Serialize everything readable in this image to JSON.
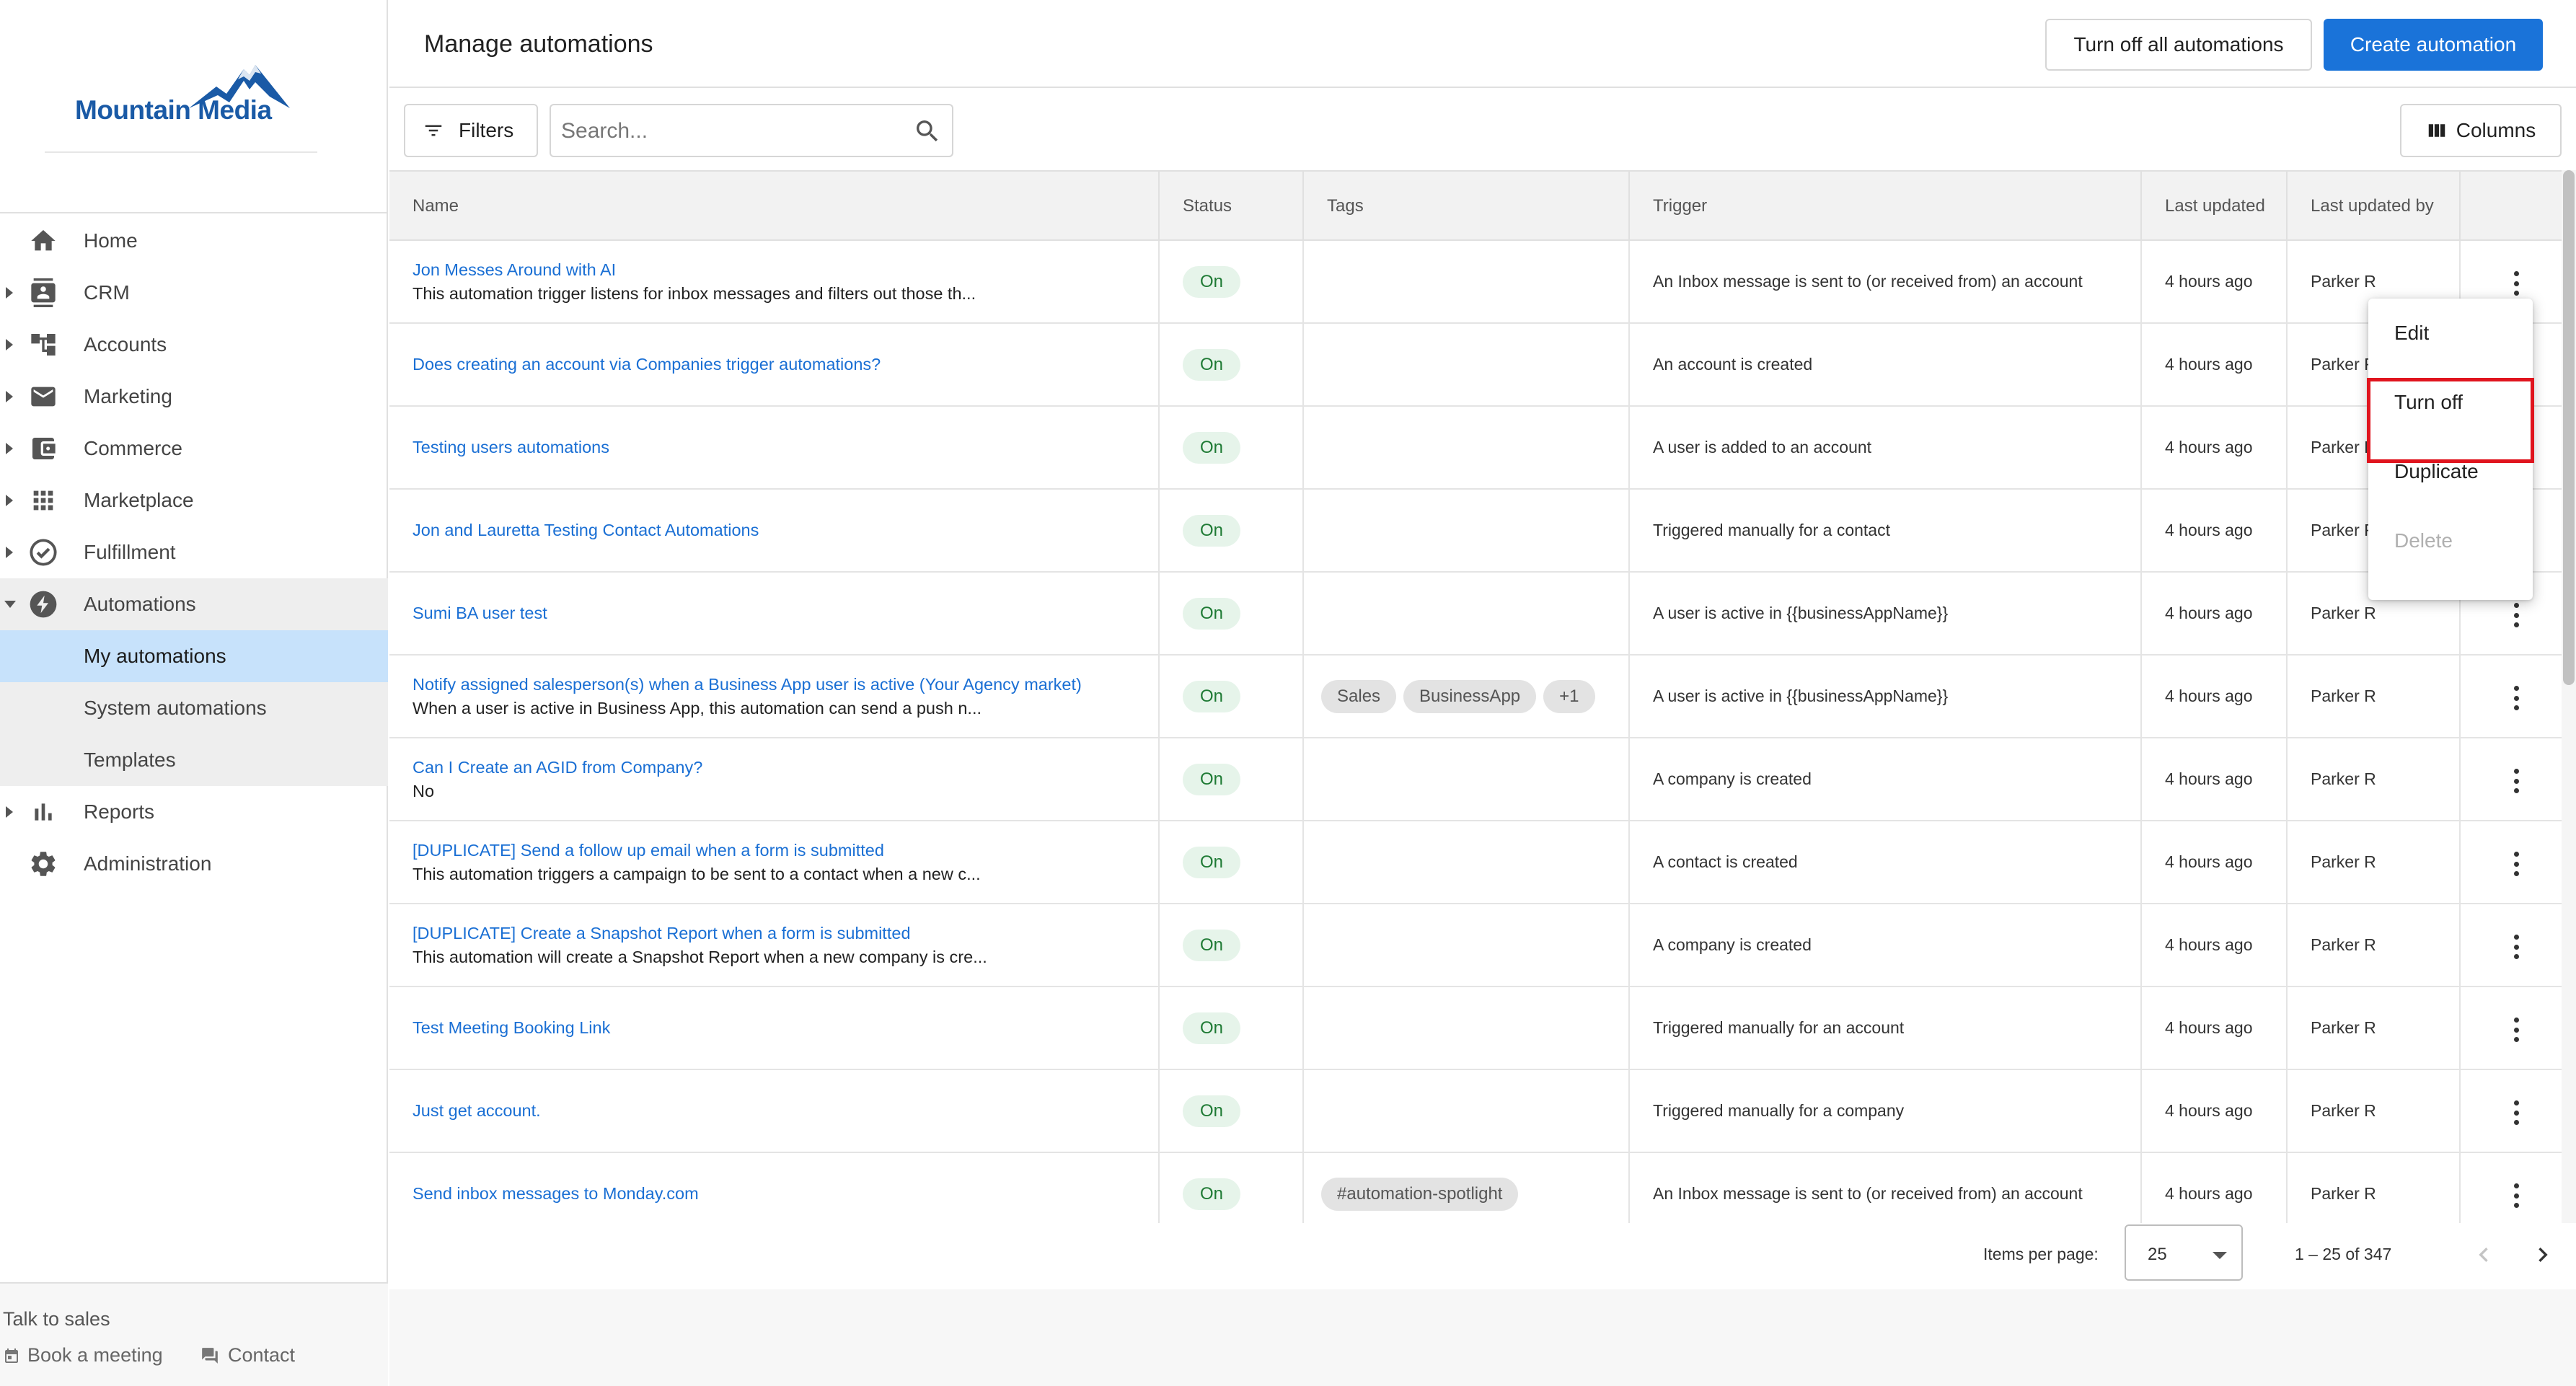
{
  "brand": {
    "name": "Mountain Media",
    "color": "#1a5aa6"
  },
  "sidebar": {
    "nav": [
      {
        "label": "Home",
        "icon": "home-icon"
      },
      {
        "label": "CRM",
        "icon": "contacts-icon"
      },
      {
        "label": "Accounts",
        "icon": "hierarchy-icon"
      },
      {
        "label": "Marketing",
        "icon": "mail-icon"
      },
      {
        "label": "Commerce",
        "icon": "wallet-icon"
      },
      {
        "label": "Marketplace",
        "icon": "apps-grid-icon"
      },
      {
        "label": "Fulfillment",
        "icon": "check-circle-icon"
      },
      {
        "label": "Automations",
        "icon": "bolt-icon"
      },
      {
        "label": "My automations"
      },
      {
        "label": "System automations"
      },
      {
        "label": "Templates"
      },
      {
        "label": "Reports",
        "icon": "bar-chart-icon"
      },
      {
        "label": "Administration",
        "icon": "gear-icon"
      }
    ],
    "talk_label": "Talk to sales",
    "book_meeting": "Book a meeting",
    "contact": "Contact"
  },
  "header": {
    "title": "Manage automations",
    "turn_off_all": "Turn off all automations",
    "create": "Create automation",
    "accent": "#1a73d9"
  },
  "toolbar": {
    "filters": "Filters",
    "search_placeholder": "Search...",
    "columns": "Columns"
  },
  "table": {
    "columns": [
      "Name",
      "Status",
      "Tags",
      "Trigger",
      "Last updated",
      "Last updated by"
    ],
    "rows": [
      {
        "name": "Jon Messes Around with AI",
        "desc": "This automation trigger listens for inbox messages and filters out those th...",
        "status": "On",
        "tags": [],
        "trigger": "An Inbox message is sent to (or received from) an account",
        "updated": "4 hours ago",
        "by": "Parker R"
      },
      {
        "name": "Does creating an account via Companies trigger automations?",
        "desc": "",
        "status": "On",
        "tags": [],
        "trigger": "An account is created",
        "updated": "4 hours ago",
        "by": "Parker R"
      },
      {
        "name": "Testing users automations",
        "desc": "",
        "status": "On",
        "tags": [],
        "trigger": "A user is added to an account",
        "updated": "4 hours ago",
        "by": "Parker R"
      },
      {
        "name": "Jon and Lauretta Testing Contact Automations",
        "desc": "",
        "status": "On",
        "tags": [],
        "trigger": "Triggered manually for a contact",
        "updated": "4 hours ago",
        "by": "Parker R"
      },
      {
        "name": "Sumi BA user test",
        "desc": "",
        "status": "On",
        "tags": [],
        "trigger": "A user is active in {{businessAppName}}",
        "updated": "4 hours ago",
        "by": "Parker R"
      },
      {
        "name": "Notify assigned salesperson(s) when a Business App user is active (Your Agency market)",
        "desc": "When a user is active in Business App, this automation can send a push n...",
        "status": "On",
        "tags": [
          "Sales",
          "BusinessApp",
          "+1"
        ],
        "trigger": "A user is active in {{businessAppName}}",
        "updated": "4 hours ago",
        "by": "Parker R"
      },
      {
        "name": "Can I Create an AGID from Company?",
        "desc": "No",
        "status": "On",
        "tags": [],
        "trigger": "A company is created",
        "updated": "4 hours ago",
        "by": "Parker R"
      },
      {
        "name": "[DUPLICATE] Send a follow up email when a form is submitted",
        "desc": "This automation triggers a campaign to be sent to a contact when a new c...",
        "status": "On",
        "tags": [],
        "trigger": "A contact is created",
        "updated": "4 hours ago",
        "by": "Parker R"
      },
      {
        "name": "[DUPLICATE] Create a Snapshot Report when a form is submitted",
        "desc": "This automation will create a Snapshot Report when a new company is cre...",
        "status": "On",
        "tags": [],
        "trigger": "A company is created",
        "updated": "4 hours ago",
        "by": "Parker R"
      },
      {
        "name": "Test Meeting Booking Link",
        "desc": "",
        "status": "On",
        "tags": [],
        "trigger": "Triggered manually for an account",
        "updated": "4 hours ago",
        "by": "Parker R"
      },
      {
        "name": "Just get account.",
        "desc": "",
        "status": "On",
        "tags": [],
        "trigger": "Triggered manually for a company",
        "updated": "4 hours ago",
        "by": "Parker R"
      },
      {
        "name": "Send inbox messages to Monday.com",
        "desc": "",
        "status": "On",
        "tags": [
          "#automation-spotlight"
        ],
        "trigger": "An Inbox message is sent to (or received from) an account",
        "updated": "4 hours ago",
        "by": "Parker R"
      }
    ]
  },
  "paginator": {
    "items_per_page_label": "Items per page:",
    "items_per_page": "25",
    "range": "1 – 25 of 347"
  },
  "context_menu": {
    "items": [
      "Edit",
      "Turn off",
      "Duplicate",
      "Delete"
    ],
    "highlight_color": "#e0141e"
  },
  "status_color": "#1e7a34"
}
